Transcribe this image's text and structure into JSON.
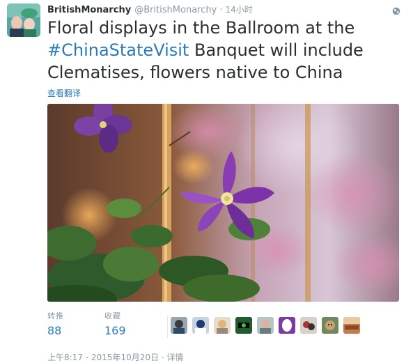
{
  "account": {
    "display_name": "BritishMonarchy",
    "handle": "@BritishMonarchy",
    "separator": "·",
    "relative_time": "14小时"
  },
  "tweet": {
    "line1": "Floral displays in the Ballroom at the",
    "hashtag": "#ChinaStateVisit",
    "line2_rest": " Banquet will include",
    "line3": "Clematises, flowers native to China",
    "translate_label": "查看翻译"
  },
  "stats": {
    "retweets_label": "转推",
    "retweets_value": "88",
    "likes_label": "收藏",
    "likes_value": "169"
  },
  "footer": {
    "timestamp": "上午8:17 - 2015年10月20日",
    "separator": "·",
    "details_label": "详情"
  },
  "colors": {
    "link": "#2b7bb9",
    "meta": "#8899a6",
    "text": "#292f33"
  },
  "icons": {
    "globe": "globe-icon"
  }
}
